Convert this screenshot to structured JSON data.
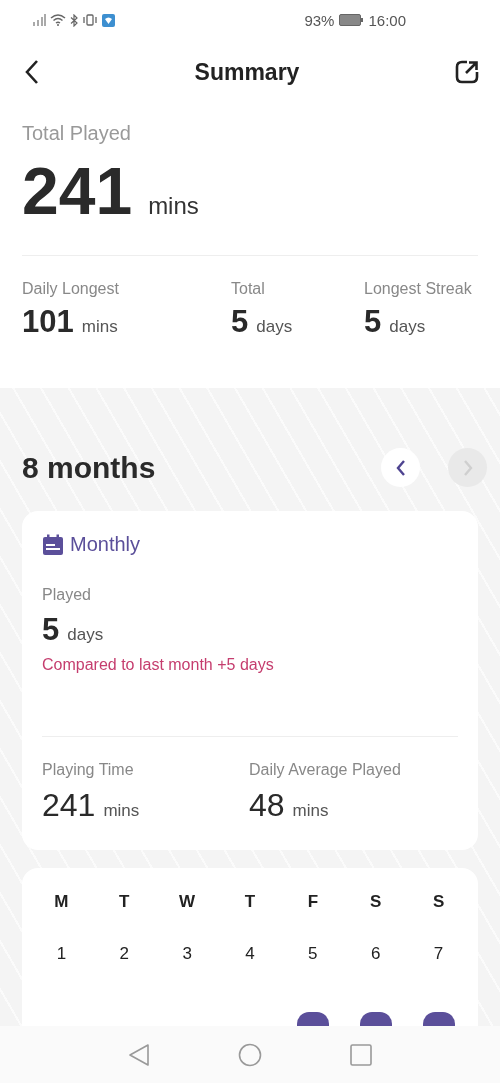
{
  "status_bar": {
    "battery": "93%",
    "time": "16:00"
  },
  "header": {
    "title": "Summary"
  },
  "total": {
    "label": "Total Played",
    "value": "241",
    "unit": "mins"
  },
  "stats": [
    {
      "label": "Daily Longest",
      "value": "101",
      "unit": "mins"
    },
    {
      "label": "Total",
      "value": "5",
      "unit": "days"
    },
    {
      "label": "Longest Streak",
      "value": "5",
      "unit": "days"
    }
  ],
  "period": {
    "title": "8 months",
    "prev_disabled": false,
    "next_disabled": true
  },
  "monthly": {
    "title": "Monthly",
    "played_label": "Played",
    "played_value": "5",
    "played_unit": "days",
    "comparison": "Compared to last month +5 days",
    "metrics": [
      {
        "label": "Playing Time",
        "value": "241",
        "unit": "mins"
      },
      {
        "label": "Daily Average Played",
        "value": "48",
        "unit": "mins"
      }
    ]
  },
  "calendar": {
    "weekdays": [
      "M",
      "T",
      "W",
      "T",
      "F",
      "S",
      "S"
    ],
    "days": [
      {
        "day": "1",
        "played": false
      },
      {
        "day": "2",
        "played": false
      },
      {
        "day": "3",
        "played": false
      },
      {
        "day": "4",
        "played": false
      },
      {
        "day": "5",
        "played": false
      },
      {
        "day": "6",
        "played": false
      },
      {
        "day": "7",
        "played": false
      }
    ],
    "partial_row": [
      {
        "played": false
      },
      {
        "played": false
      },
      {
        "played": false
      },
      {
        "played": false
      },
      {
        "played": true
      },
      {
        "played": true
      },
      {
        "played": true
      }
    ]
  }
}
